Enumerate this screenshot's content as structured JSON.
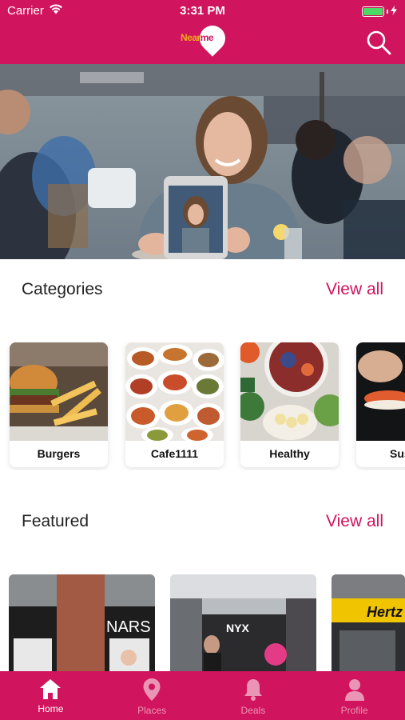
{
  "status_bar": {
    "carrier": "Carrier",
    "time": "3:31 PM",
    "battery_level": 1.0
  },
  "header": {
    "logo": {
      "word1": "Near",
      "word2": "me"
    },
    "search_icon": "search-icon"
  },
  "colors": {
    "brand": "#d0145d",
    "accent_link": "#d0145d",
    "battery": "#4cd964"
  },
  "hero": {
    "image": "photo-woman-holding-smartphone-in-restaurant"
  },
  "categories": {
    "title": "Categories",
    "view_all": "View all",
    "items": [
      {
        "label": "Burgers",
        "image": "burger-and-fries-photo"
      },
      {
        "label": "Cafe1111",
        "image": "cafe-dishes-photo"
      },
      {
        "label": "Healthy",
        "image": "healthy-bowls-photo"
      },
      {
        "label": "Sus",
        "image": "sushi-photo"
      }
    ]
  },
  "featured": {
    "title": "Featured",
    "view_all": "View all",
    "items": [
      {
        "sign": "NARS",
        "image": "nars-store-front-photo"
      },
      {
        "sign": "NYX",
        "image": "nyx-store-interior-photo"
      },
      {
        "sign": "Hertz",
        "image": "hertz-storefront-photo"
      }
    ]
  },
  "tabbar": {
    "active": "Home",
    "items": [
      {
        "label": "Home",
        "icon": "home-icon"
      },
      {
        "label": "Places",
        "icon": "location-pin-icon"
      },
      {
        "label": "Deals",
        "icon": "bell-icon"
      },
      {
        "label": "Profile",
        "icon": "person-icon"
      }
    ]
  }
}
